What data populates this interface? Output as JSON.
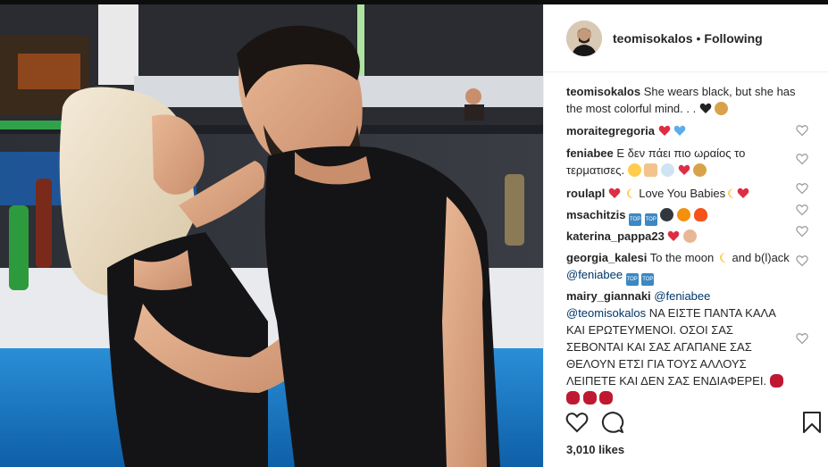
{
  "post": {
    "username": "teomisokalos",
    "separator": "•",
    "follow_status": "Following",
    "likes": "3,010 likes"
  },
  "comments": [
    {
      "user": "teomisokalos",
      "text": " She wears black, but she has the most colorful mind. . .",
      "emojis": [
        "black-heart",
        "cookie"
      ]
    },
    {
      "user": "moraitegregoria",
      "text": "",
      "emojis": [
        "red-heart",
        "blue-heart"
      ]
    },
    {
      "user": "feniabee",
      "text": " Ε δεν πάει πιο ωραίος το τερματισες.",
      "emojis": [
        "grimace",
        "couple",
        "ring",
        "red-heart",
        "cookie"
      ]
    },
    {
      "user": "roulapl",
      "text_before": " ",
      "emojis_before": [
        "heart-exclamation",
        "moon"
      ],
      "text": "Love You Babies",
      "emojis": [
        "moon",
        "heart-exclamation"
      ]
    },
    {
      "user": "msachitzis",
      "text": " ",
      "emojis": [
        "top",
        "top",
        "bomb",
        "explosion",
        "fire"
      ]
    },
    {
      "user": "katerina_pappa23",
      "text": " ",
      "emojis": [
        "red-heart",
        "ok-hand"
      ]
    },
    {
      "user": "georgia_kalesi",
      "text": " To the moon",
      "text2": " and b(l)ack ",
      "mention": "@feniabee",
      "emojis_mid": [
        "moon"
      ],
      "emojis": [
        "top",
        "top"
      ]
    },
    {
      "user": "mairy_giannaki",
      "mention1": "@feniabee",
      "mention2": "@teomisokalos",
      "text": " ΝΑ ΕΙΣΤΕ ΠΑΝΤΑ ΚΑΛΑ ΚΑΙ ΕΡΩΤΕΥΜΕΝΟΙ. ΟΣΟΙ ΣΑΣ ΣΕΒΟΝΤΑΙ ΚΑΙ ΣΑΣ ΑΓΑΠΑΝΕ ΣΑΣ ΘΕΛΟΥΝ ΕΤΣΙ ΓΙΑ ΤΟΥΣ ΑΛΛΟΥΣ ΛΕΙΠΕΤΕ ΚΑΙ ΔΕΝ ΣΑΣ ΕΝΔΙΑΦΕΡΕΙ.",
      "emojis": [
        "lips",
        "lips",
        "lips",
        "lips"
      ]
    }
  ],
  "colors": {
    "text": "#262626",
    "mention": "#003569",
    "divider": "#efefef",
    "heart_icon": "#999999"
  },
  "icons": {
    "like": "heart-outline-icon",
    "comment": "speech-bubble-icon",
    "save": "bookmark-icon",
    "comment_like": "small-heart-icon"
  }
}
